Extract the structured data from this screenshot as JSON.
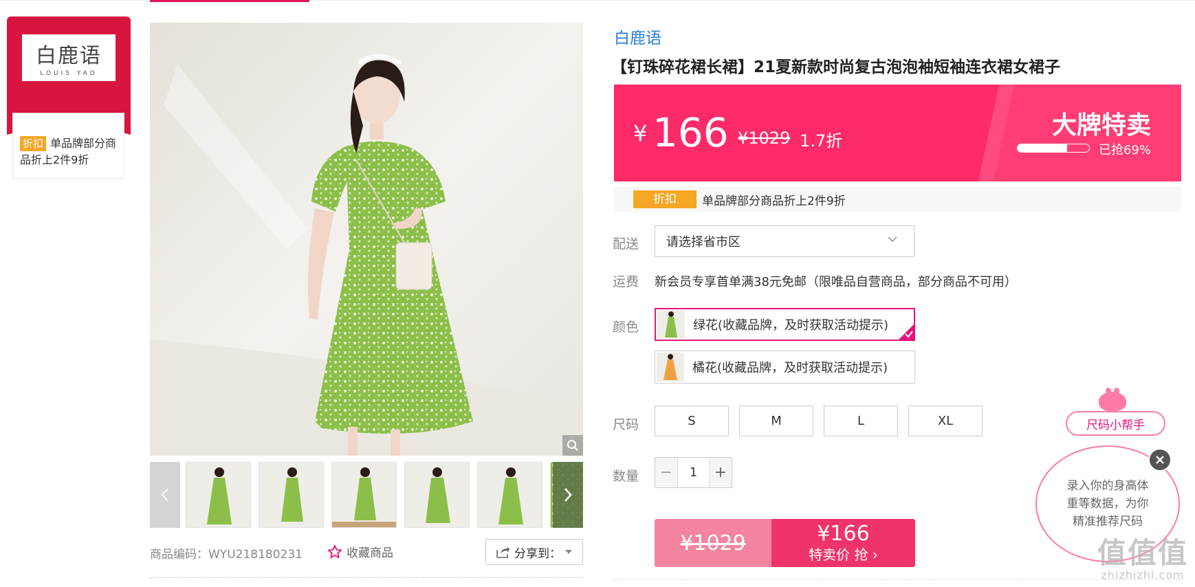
{
  "brand_card": {
    "logo_cn": "白鹿语",
    "logo_en": "LOUIS YAO",
    "tag": "折扣",
    "promo": "单品牌部分商品折上2件9折"
  },
  "gallery": {
    "thumb_count": 6
  },
  "below_image": {
    "product_code": "商品编码：WYU218180231",
    "favorite_label": "收藏商品",
    "share_label": "分享到："
  },
  "product": {
    "brand": "白鹿语",
    "title": "【钉珠碎花裙长裙】21夏新款时尚复古泡泡袖短袖连衣裙女裙子"
  },
  "price_banner": {
    "yen": "¥",
    "price": "166",
    "original": "¥1029",
    "discount": "1.7折",
    "sale_title": "大牌特卖",
    "progress_fraction": 0.69,
    "progress_text": "已抢69%",
    "color": "#ff2a68"
  },
  "promo_row": {
    "tag": "折扣",
    "text": "单品牌部分商品折上2件9折"
  },
  "delivery": {
    "label": "配送",
    "placeholder": "请选择省市区"
  },
  "shipping": {
    "label": "运费",
    "text": "新会员专享首单满38元免邮（限唯品自营商品，部分商品不可用）"
  },
  "color": {
    "label": "颜色",
    "options": [
      {
        "label": "绿花(收藏品牌，及时获取活动提示)",
        "selected": true
      },
      {
        "label": "橘花(收藏品牌，及时获取活动提示)",
        "selected": false
      }
    ]
  },
  "size": {
    "label": "尺码",
    "options": [
      "S",
      "M",
      "L",
      "XL"
    ]
  },
  "quantity": {
    "label": "数量",
    "value": "1",
    "minus": "−",
    "plus": "+"
  },
  "buy": {
    "original": "¥1029",
    "price": "¥166",
    "cta": "特卖价 抢 ›"
  },
  "size_helper": {
    "button": "尺码小帮手",
    "bubble": "录入你的身高体重等数据，为你精准推荐尺码"
  },
  "watermark": {
    "big": "值值值",
    "small": "zhizhizhi.com"
  },
  "colors": {
    "accent_pink": "#e6127b",
    "brand_red": "#d8153f",
    "link_blue": "#2b7fd6",
    "tag_orange": "#f5a623"
  }
}
